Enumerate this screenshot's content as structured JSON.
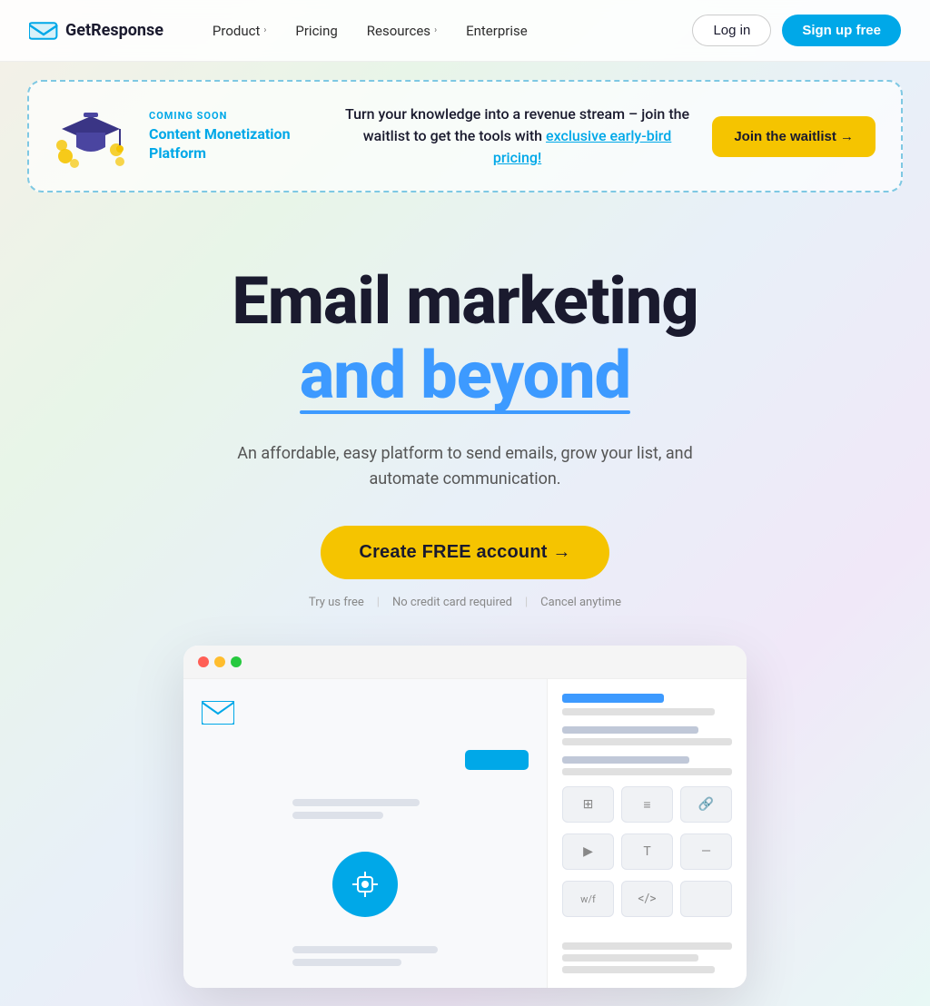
{
  "brand": {
    "name": "GetResponse",
    "logo_alt": "GetResponse logo"
  },
  "nav": {
    "links": [
      {
        "label": "Product",
        "has_chevron": true
      },
      {
        "label": "Pricing",
        "has_chevron": false
      },
      {
        "label": "Resources",
        "has_chevron": true
      },
      {
        "label": "Enterprise",
        "has_chevron": false
      }
    ],
    "login_label": "Log in",
    "signup_label": "Sign up free"
  },
  "banner": {
    "coming_soon": "COMING SOON",
    "platform_name": "Content Monetization Platform",
    "description_plain": "Turn your knowledge into a revenue stream – join the waitlist to get the tools with ",
    "description_highlight": "exclusive early-bird pricing!",
    "cta_label": "Join the waitlist →"
  },
  "hero": {
    "title_main": "Email marketing",
    "title_sub": "and beyond",
    "subtitle": "An affordable, easy platform to send emails, grow your list, and automate communication.",
    "cta_label": "Create FREE account →",
    "trust_items": [
      "Try us free",
      "No credit card required",
      "Cancel anytime"
    ]
  },
  "screenshot": {
    "alt": "GetResponse email editor interface"
  }
}
